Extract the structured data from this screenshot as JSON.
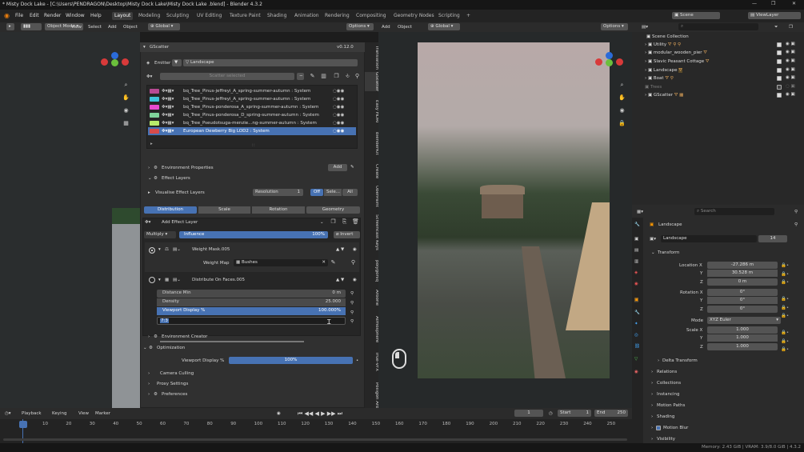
{
  "window": {
    "title": "* Misty Dock Lake - [C:\\Users\\PENDRAGON\\Desktop\\Misty Dock Lake\\Misty Dock Lake .blend] - Blender 4.3.2"
  },
  "menus": [
    "File",
    "Edit",
    "Render",
    "Window",
    "Help"
  ],
  "workspaces": [
    "Layout",
    "Modeling",
    "Sculpting",
    "UV Editing",
    "Texture Paint",
    "Shading",
    "Animation",
    "Rendering",
    "Compositing",
    "Geometry Nodes",
    "Scripting",
    "+"
  ],
  "scene_field": "Scene",
  "view_layer_field": "ViewLayer",
  "viewport_header": {
    "mode": "Object Mode",
    "items": [
      "View",
      "Select",
      "Add",
      "Object"
    ],
    "transform": "Global",
    "options": "Options"
  },
  "viewport2_header": {
    "items": [
      "Add",
      "Object"
    ],
    "transform": "Global",
    "options": "Options"
  },
  "gscatter": {
    "title": "GScatter",
    "version": "v0.12.0",
    "emitter_label": "Emitter",
    "emitter_value": "Landscape",
    "scatter_selected": "Scatter selected",
    "items": [
      {
        "label": "bq_Tree_Pinus-jeffreyi_A_spring-summer-autumn : System",
        "color": "#b84a93"
      },
      {
        "label": "bq_Tree_Pinus-jeffreyi_A_spring-summer-autumn : System",
        "color": "#3ec3d9"
      },
      {
        "label": "bq_Tree_Pinus-ponderosa_A_spring-summer-autumn : System",
        "color": "#e64bd0"
      },
      {
        "label": "bq_Tree_Pinus-ponderosa_D_spring-summer-autumn : System",
        "color": "#7fd49b"
      },
      {
        "label": "bq_Tree_Pseudotsuga-menzie...ng-summer-autumn : System",
        "color": "#b8ea6b"
      },
      {
        "label": "European Dewberry Big LOD2 : System",
        "color": "#d84b4b"
      }
    ],
    "env_props": "Environment Properties",
    "add": "Add",
    "effect_layers": "Effect Layers",
    "visualise": "Visualise Effect Layers",
    "resolution": "Resolution",
    "resolution_value": "1",
    "vis_toggle": [
      "Off",
      "Sele...",
      "All"
    ],
    "tabs": [
      "Distribution",
      "Scale",
      "Rotation",
      "Geometry"
    ],
    "add_effect_layer": "Add Effect Layer",
    "blend_mode": "Multiply",
    "influence": "Influence",
    "influence_value": "100%",
    "invert": "Invert",
    "weight_mask": "Weight Mask.005",
    "weight_map": "Weight Map",
    "weight_map_value": "Bushes",
    "distribute": "Distribute On Faces.005",
    "params": [
      {
        "name": "Distance Min",
        "value": "0 m"
      },
      {
        "name": "Density",
        "value": "25.000"
      },
      {
        "name": "Viewport Display %",
        "value": "100.000%"
      }
    ],
    "typed": "7:3",
    "env_creator": "Environment Creator",
    "optimization": "Optimization",
    "opt_viewport": "Viewport Display %",
    "opt_viewport_value": "100%",
    "camera_culling": "Camera Culling",
    "proxy_settings": "Proxy Settings",
    "preferences": "Preferences"
  },
  "sidebar_tabs": [
    "Translation",
    "GScatter",
    "Easy HDRI",
    "BlenderKit",
    "Create",
    "UberPaint",
    "Screencast Keys",
    "polygoniq",
    "Arborie",
    "Atmosphere",
    "True-VFX",
    "Poliigon Arb"
  ],
  "outliner": {
    "search": "",
    "rows": [
      {
        "label": "Scene Collection",
        "indent": 0
      },
      {
        "label": "Utility",
        "indent": 1
      },
      {
        "label": "modular_wooden_pier",
        "indent": 1
      },
      {
        "label": "Slavic Peasant Cottage",
        "indent": 1
      },
      {
        "label": "Landscape",
        "indent": 1
      },
      {
        "label": "Boat",
        "indent": 1
      },
      {
        "label": "Trees",
        "indent": 1
      },
      {
        "label": "GScatter",
        "indent": 1
      }
    ]
  },
  "properties": {
    "search_placeholder": "Search",
    "object": "Landscape",
    "mesh": "Landscape",
    "users": "14",
    "transform": "Transform",
    "location_label": "Location X",
    "location": [
      "-27.286 m",
      "30.528 m",
      "0 m"
    ],
    "rotation_label": "Rotation X",
    "rotation": [
      "0°",
      "0°",
      "0°"
    ],
    "mode_label": "Mode",
    "mode": "XYZ Euler",
    "scale_label": "Scale X",
    "scale": [
      "1.000",
      "1.000",
      "1.000"
    ],
    "axes": [
      "Y",
      "Z"
    ],
    "sections": [
      "Delta Transform",
      "Relations",
      "Collections",
      "Instancing",
      "Motion Paths",
      "Shading",
      "Motion Blur",
      "Visibility"
    ]
  },
  "timeline": {
    "items": [
      "Playback",
      "Keying",
      "View",
      "Marker"
    ],
    "frame": "1",
    "start_label": "Start",
    "start": "1",
    "end_label": "End",
    "end": "250",
    "ticks": [
      "1",
      "10",
      "20",
      "30",
      "40",
      "50",
      "60",
      "70",
      "80",
      "90",
      "100",
      "110",
      "120",
      "130",
      "140",
      "150",
      "160",
      "170",
      "180",
      "190",
      "200",
      "210",
      "220",
      "230",
      "240",
      "250"
    ]
  },
  "status": {
    "text": "Memory: 2.43 GiB | VRAM: 3.9/8.0 GiB | 4.3.2"
  },
  "colors": {
    "accent": "#4772b3",
    "panel": "#303030",
    "header": "#2b2b2b"
  }
}
